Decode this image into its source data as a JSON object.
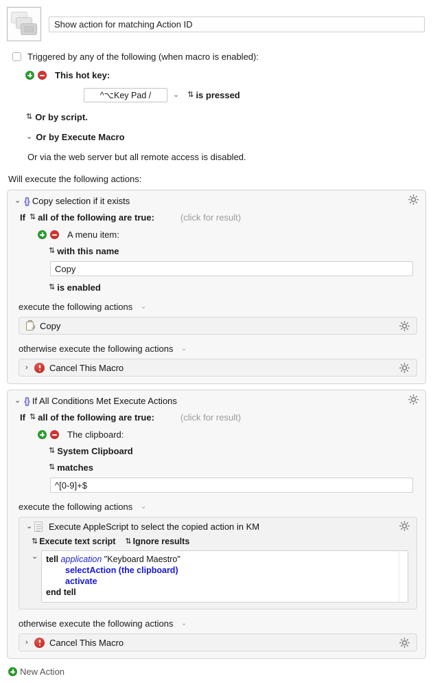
{
  "macro": {
    "icon_name": "cascading-windows-icon",
    "name": "Show action for matching Action ID"
  },
  "trigger": {
    "enabled_label": "Triggered by any of the following (when macro is enabled):",
    "checkbox_checked": false,
    "hotkey_label": "This hot key:",
    "hotkey_value": "^⌥Key Pad /",
    "hotkey_state": "is pressed",
    "or_by_script": "Or by script.",
    "or_by_execute_macro": "Or by Execute Macro",
    "webserver_note": "Or via the web server but all remote access is disabled."
  },
  "actions_intro": "Will execute the following actions:",
  "groups": [
    {
      "title": "Copy selection if it exists",
      "icon": "braces-icon",
      "if_prefix": "If",
      "if_condition": "all of the following are true:",
      "result_hint": "(click for result)",
      "condition": {
        "label": "A menu item:",
        "qualifier": "with this name",
        "value": "Copy",
        "state": "is enabled"
      },
      "then_label": "execute the following actions",
      "then_action": {
        "title": "Copy",
        "icon": "clipboard-icon"
      },
      "else_label": "otherwise execute the following actions",
      "else_action": {
        "title": "Cancel This Macro",
        "icon": "stop-error-icon"
      }
    },
    {
      "title": "If All Conditions Met Execute Actions",
      "icon": "braces-icon",
      "if_prefix": "If",
      "if_condition": "all of the following are true:",
      "result_hint": "(click for result)",
      "condition": {
        "label": "The clipboard:",
        "source": "System Clipboard",
        "operator": "matches",
        "value": "^[0-9]+$"
      },
      "then_label": "execute the following actions",
      "then_action": {
        "title": "Execute AppleScript to select the copied action in KM",
        "icon": "script-document-icon",
        "script_type": "Execute text script",
        "results_mode": "Ignore results",
        "script_lines": [
          {
            "parts": [
              {
                "t": "tell ",
                "s": "kw"
              },
              {
                "t": "application ",
                "s": "app"
              },
              {
                "t": "\"Keyboard Maestro\"",
                "s": "str"
              }
            ],
            "indent": 0
          },
          {
            "parts": [
              {
                "t": "selectAction (the clipboard)",
                "s": "fn"
              }
            ],
            "indent": 1
          },
          {
            "parts": [
              {
                "t": "activate",
                "s": "fn"
              }
            ],
            "indent": 1
          },
          {
            "parts": [
              {
                "t": "end tell",
                "s": "kw"
              }
            ],
            "indent": 0
          }
        ]
      },
      "else_label": "otherwise execute the following actions",
      "else_action": {
        "title": "Cancel This Macro",
        "icon": "stop-error-icon"
      }
    }
  ],
  "footer": {
    "new_action_label": "New Action"
  },
  "colors": {
    "accent_brace": "#6f6fe0",
    "add_green": "#2a9c2f",
    "remove_red": "#cf3331",
    "cancel_red": "#c22e26",
    "script_keyword": "#1616d8",
    "muted_text": "#9b9b9b"
  }
}
